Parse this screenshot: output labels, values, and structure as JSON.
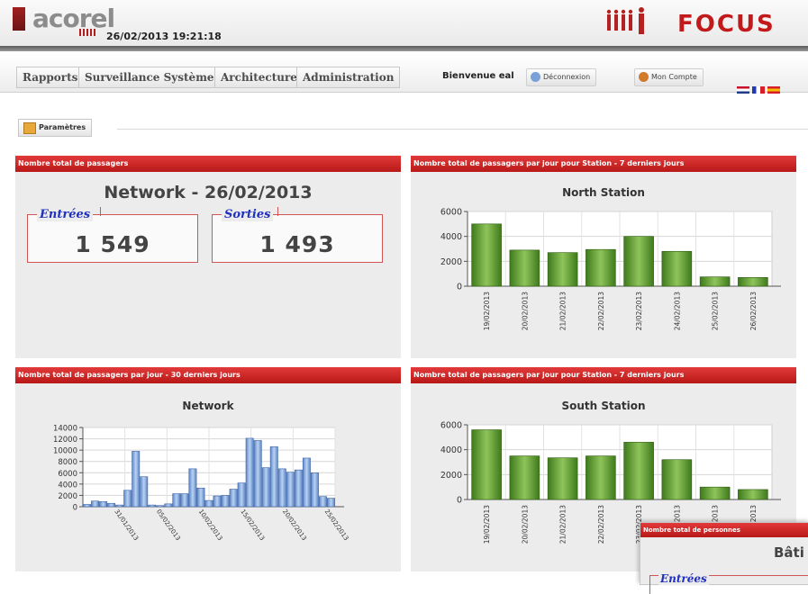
{
  "header": {
    "logo_text": "acorel",
    "datetime": "26/02/2013 19:21:18",
    "brand": "FOCUS"
  },
  "nav": {
    "tabs": [
      "Rapports",
      "Surveillance Système",
      "Architecture",
      "Administration"
    ],
    "welcome": "Bienvenue eal",
    "logout": "Déconnexion",
    "account": "Mon Compte"
  },
  "params_tab": "Paramètres",
  "panels": {
    "total": {
      "header": "Nombre total de passagers",
      "title": "Network - 26/02/2013",
      "entries_label": "Entrées",
      "entries_value": "1 549",
      "exits_label": "Sorties",
      "exits_value": "1 493"
    },
    "north": {
      "header": "Nombre total de passagers par jour pour Station - 7 derniers jours"
    },
    "network30": {
      "header": "Nombre total de passagers par jour - 30 derniers jours"
    },
    "south": {
      "header": "Nombre total de passagers par jour pour Station - 7 derniers jours"
    }
  },
  "popup": {
    "header": "Nombre total de personnes",
    "title": "Bâti",
    "entries_label": "Entrées"
  },
  "colors": {
    "header_red": "#c41e1e",
    "bar_green": "#5f9a2e",
    "bar_blue": "#8db0e0",
    "entries_blue": "#2030c0"
  },
  "chart_data": [
    {
      "type": "bar",
      "title": "North Station",
      "categories": [
        "19/02/2013",
        "20/02/2013",
        "21/02/2013",
        "22/02/2013",
        "23/02/2013",
        "24/02/2013",
        "25/02/2013",
        "26/02/2013"
      ],
      "values": [
        5000,
        2900,
        2700,
        2950,
        4000,
        2800,
        750,
        700
      ],
      "ylim": [
        0,
        6000
      ],
      "yticks": [
        "6000",
        "4000",
        "2000",
        "0"
      ],
      "xlabel": "",
      "ylabel": "",
      "grid": true
    },
    {
      "type": "bar",
      "title": "Network",
      "categories": [
        "31/01/2013",
        "05/02/2013",
        "10/02/2013",
        "15/02/2013",
        "20/02/2013",
        "25/02/2013"
      ],
      "values": [
        400,
        1000,
        900,
        600,
        300,
        2900,
        9800,
        5300,
        300,
        200,
        500,
        2300,
        2300,
        6700,
        3300,
        1100,
        1900,
        2000,
        3100,
        4200,
        12100,
        11700,
        6900,
        10600,
        6700,
        6100,
        6500,
        8600,
        6000,
        1800,
        1500
      ],
      "ylim": [
        0,
        14000
      ],
      "yticks": [
        "14000",
        "12000",
        "10000",
        "8000",
        "6000",
        "4000",
        "2000",
        "0"
      ],
      "xlabel": "",
      "ylabel": "",
      "grid": true
    },
    {
      "type": "bar",
      "title": "South Station",
      "categories": [
        "19/02/2013",
        "20/02/2013",
        "21/02/2013",
        "22/02/2013",
        "23/02/2013",
        "24/02/2013",
        "25/02/2013",
        "26/02/2013"
      ],
      "values": [
        5600,
        3500,
        3350,
        3500,
        4600,
        3200,
        1000,
        800
      ],
      "ylim": [
        0,
        6000
      ],
      "yticks": [
        "6000",
        "4000",
        "2000",
        "0"
      ],
      "xlabel": "",
      "ylabel": "",
      "grid": true
    }
  ]
}
